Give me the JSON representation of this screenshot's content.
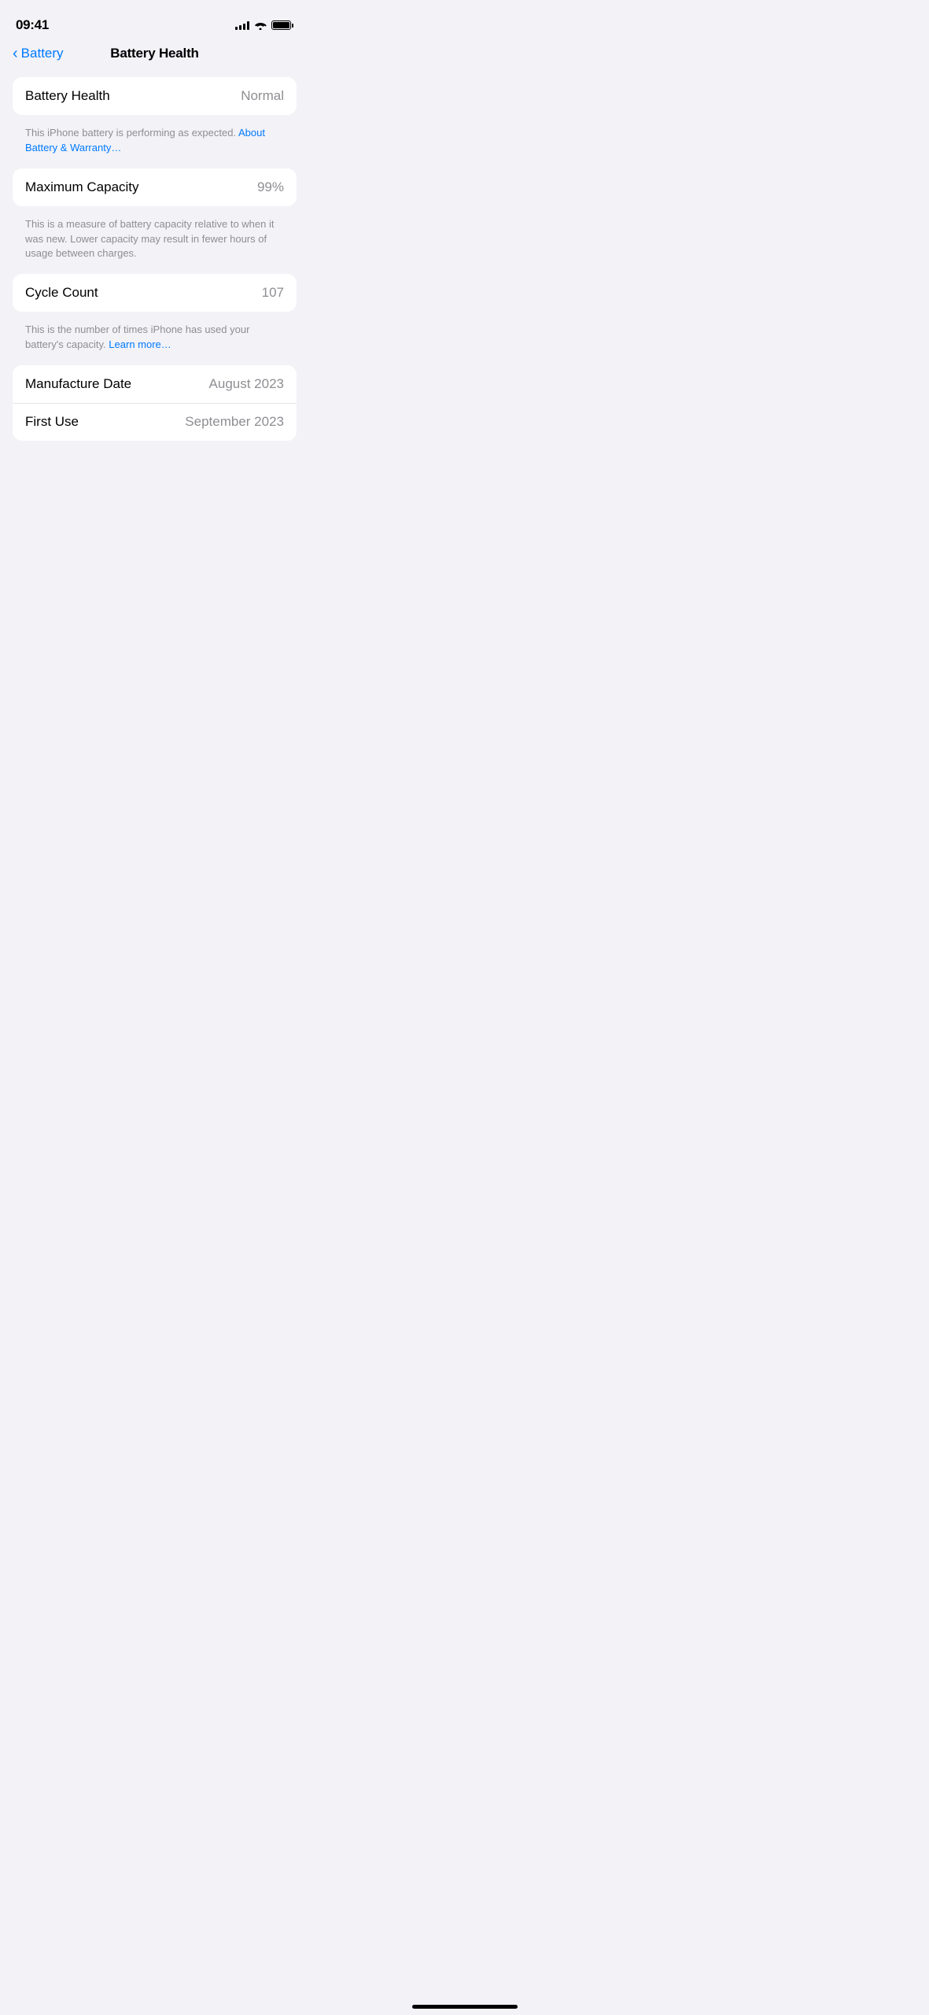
{
  "statusBar": {
    "time": "09:41",
    "batteryFull": true
  },
  "header": {
    "backLabel": "Battery",
    "title": "Battery Health"
  },
  "sections": [
    {
      "id": "battery-health-section",
      "rows": [
        {
          "label": "Battery Health",
          "value": "Normal"
        }
      ],
      "description": {
        "text": "This iPhone battery is performing as expected. ",
        "linkText": "About Battery & Warranty…",
        "linkHref": "#"
      }
    },
    {
      "id": "max-capacity-section",
      "rows": [
        {
          "label": "Maximum Capacity",
          "value": "99%"
        }
      ],
      "description": {
        "text": "This is a measure of battery capacity relative to when it was new. Lower capacity may result in fewer hours of usage between charges.",
        "linkText": null
      }
    },
    {
      "id": "cycle-count-section",
      "rows": [
        {
          "label": "Cycle Count",
          "value": "107"
        }
      ],
      "description": {
        "text": "This is the number of times iPhone has used your battery's capacity. ",
        "linkText": "Learn more…",
        "linkHref": "#"
      }
    },
    {
      "id": "dates-section",
      "rows": [
        {
          "label": "Manufacture Date",
          "value": "August 2023"
        },
        {
          "label": "First Use",
          "value": "September 2023"
        }
      ],
      "description": null
    }
  ]
}
